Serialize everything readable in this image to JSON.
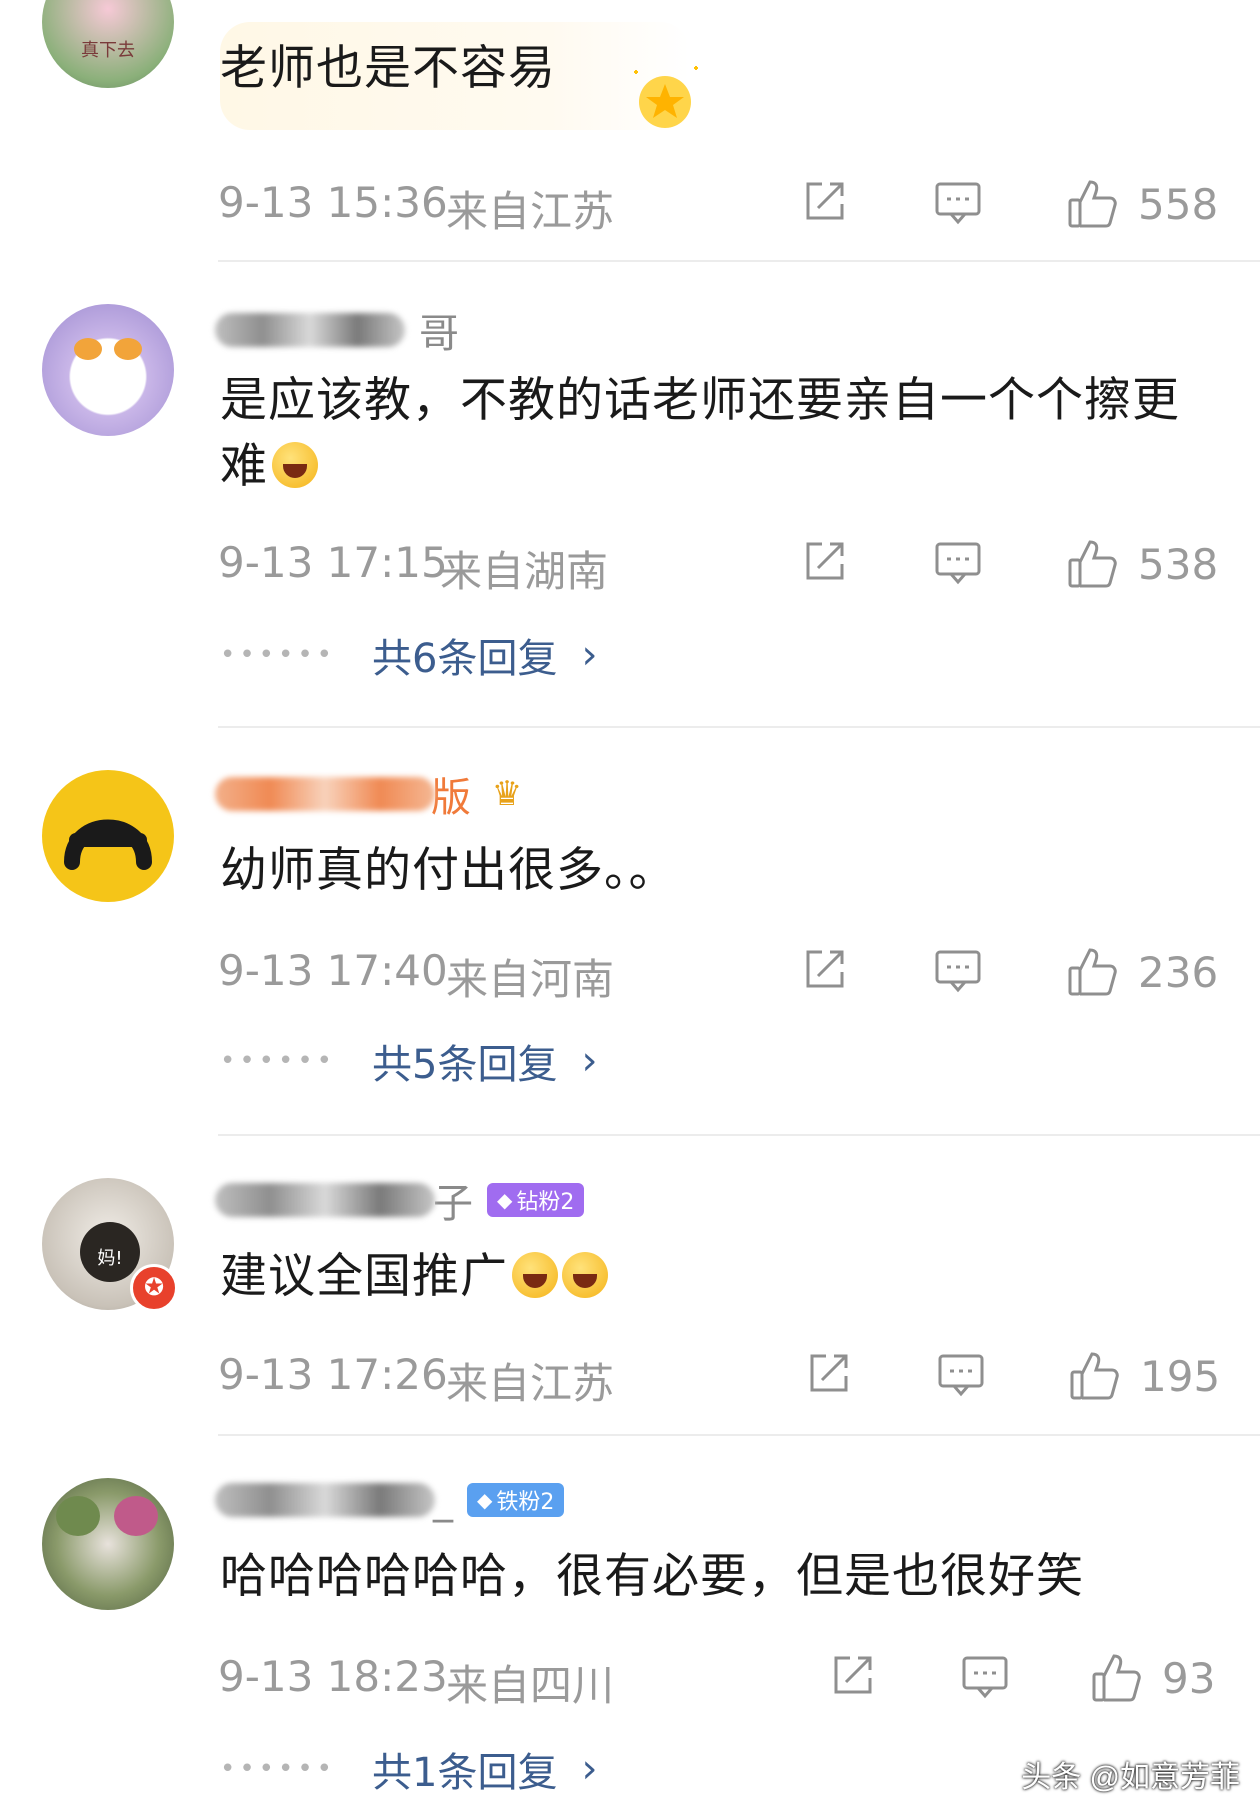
{
  "comments": [
    {
      "name_suffix": "",
      "text": "老师也是不容易",
      "time": "9-13 15:36",
      "location": "来自江苏",
      "likes": "558"
    },
    {
      "name_suffix": "哥",
      "text": "是应该教，不教的话老师还要亲自一个个擦更难",
      "time": "9-13 17:15",
      "location": "来自湖南",
      "likes": "538",
      "replies": "共6条回复"
    },
    {
      "name_suffix": "版",
      "text": "幼师真的付出很多。。",
      "time": "9-13 17:40",
      "location": "来自河南",
      "likes": "236",
      "replies": "共5条回复"
    },
    {
      "name_suffix": "子",
      "badge": "钻粉2",
      "text": "建议全国推广",
      "time": "9-13 17:26",
      "location": "来自江苏",
      "likes": "195"
    },
    {
      "name_suffix": "_",
      "badge": "铁粉2",
      "text": "哈哈哈哈哈哈，很有必要，但是也很好笑",
      "time": "9-13 18:23",
      "location": "来自四川",
      "likes": "93",
      "replies": "共1条回复"
    }
  ],
  "avatar_captions": {
    "c1": "真下去",
    "c4": "妈!"
  },
  "watermark": "头条 @如意芳菲",
  "colors": {
    "reply_link": "#3c5d8e",
    "meta_gray": "#9a9a9a",
    "diamond_badge": "#a06cf0",
    "iron_badge": "#5aa0f0"
  }
}
